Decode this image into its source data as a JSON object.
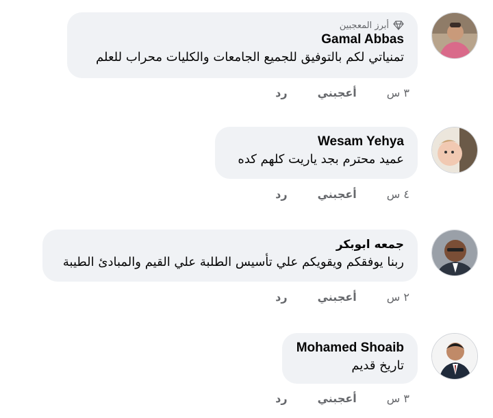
{
  "comments": [
    {
      "badge": "أبرز المعجبين",
      "author": "Gamal Abbas",
      "text": "تمنياتي لكم بالتوفيق للجميع الجامعات والكليات محراب للعلم",
      "time": "٣ س",
      "like": "أعجبني",
      "reply": "رد"
    },
    {
      "author": "Wesam Yehya",
      "text": "عميد محترم بجد ياريت كلهم كده",
      "time": "٤ س",
      "like": "أعجبني",
      "reply": "رد"
    },
    {
      "author": "جمعه ابوبكر",
      "text": "ربنا يوفقكم ويقويكم علي تأسيس الطلبة علي القيم والمبادئ الطيبة",
      "time": "٢ س",
      "like": "أعجبني",
      "reply": "رد"
    },
    {
      "author": "Mohamed Shoaib",
      "text": "تاريخ قديم",
      "time": "٣ س",
      "like": "أعجبني",
      "reply": "رد"
    }
  ],
  "icons": {
    "badge": "diamond-icon"
  },
  "colors": {
    "bubble": "#f0f2f5",
    "meta": "#65676b",
    "text": "#050505"
  }
}
